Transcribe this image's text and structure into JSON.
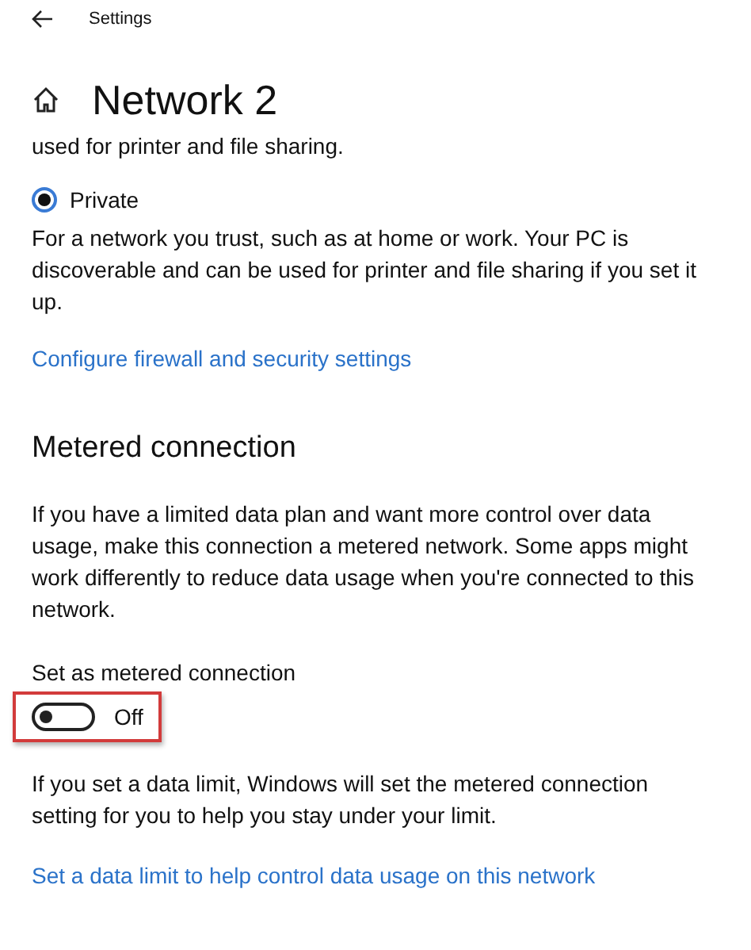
{
  "window": {
    "title": "Settings"
  },
  "page": {
    "title": "Network  2"
  },
  "cut_text": "used for printer and file sharing.",
  "profile_options": [
    {
      "label": "Private",
      "selected": true,
      "description": "For a network you trust, such as at home or work. Your PC is discoverable and can be used for printer and file sharing if you set it up."
    }
  ],
  "firewall_link": "Configure firewall and security settings",
  "metered": {
    "heading": "Metered connection",
    "description": "If you have a limited data plan and want more control over data usage, make this connection a metered network. Some apps might work differently to reduce data usage when you're connected to this network.",
    "toggle_label": "Set as metered connection",
    "toggle": {
      "on": false,
      "state_text": "Off",
      "highlighted": true
    },
    "note": "If you set a data limit, Windows will set the metered connection setting for you to help you stay under your limit.",
    "link": "Set a data limit to help control data usage on this network"
  }
}
